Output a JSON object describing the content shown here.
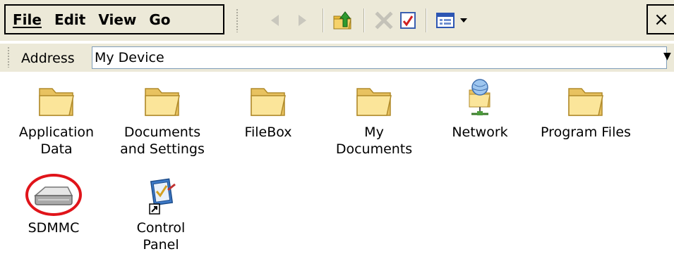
{
  "menu": {
    "file": "File",
    "edit": "Edit",
    "view": "View",
    "go": "Go"
  },
  "toolbar": {
    "back_icon": "back-arrow-icon",
    "forward_icon": "forward-arrow-icon",
    "up_icon": "up-folder-icon",
    "delete_icon": "delete-x-icon",
    "properties_icon": "properties-icon",
    "views_icon": "views-menu-icon",
    "close_label": "×"
  },
  "address": {
    "label": "Address",
    "value": "My Device"
  },
  "items": [
    {
      "label": "Application\nData",
      "icon": "folder-icon"
    },
    {
      "label": "Documents\nand Settings",
      "icon": "folder-icon"
    },
    {
      "label": "FileBox",
      "icon": "folder-icon"
    },
    {
      "label": "My\nDocuments",
      "icon": "folder-icon"
    },
    {
      "label": "Network",
      "icon": "network-folder-icon"
    },
    {
      "label": "Program Files",
      "icon": "folder-icon"
    },
    {
      "label": "SDMMC",
      "icon": "storage-card-icon"
    },
    {
      "label": "Control\nPanel",
      "icon": "control-panel-shortcut-icon"
    }
  ],
  "colors": {
    "chrome": "#ece9d8",
    "highlight_ring": "#e0141a",
    "folder": "#f6d887"
  }
}
